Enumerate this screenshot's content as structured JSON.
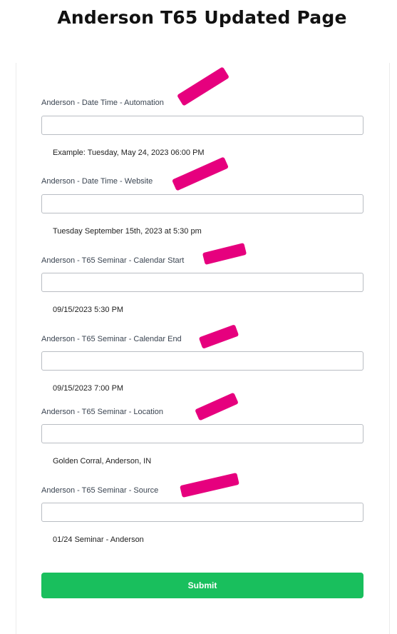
{
  "page": {
    "title": "Anderson T65 Updated Page"
  },
  "fields": [
    {
      "label": "Anderson - Date Time - Automation",
      "value": "",
      "hint": "Example: Tuesday, May 24, 2023 06:00 PM"
    },
    {
      "label": "Anderson - Date Time - Website",
      "value": "",
      "hint": "Tuesday September 15th, 2023 at 5:30 pm"
    },
    {
      "label": "Anderson - T65 Seminar - Calendar Start",
      "value": "",
      "hint": "09/15/2023 5:30 PM"
    },
    {
      "label": "Anderson - T65 Seminar - Calendar End",
      "value": "",
      "hint": "09/15/2023 7:00 PM"
    },
    {
      "label": "Anderson - T65 Seminar - Location",
      "value": "",
      "hint": "Golden Corral, Anderson, IN"
    },
    {
      "label": "Anderson - T65 Seminar - Source",
      "value": "",
      "hint": "01/24 Seminar - Anderson"
    }
  ],
  "form": {
    "submit_label": "Submit"
  },
  "colors": {
    "accent": "#19bf5d",
    "highlight": "#e6007e"
  }
}
